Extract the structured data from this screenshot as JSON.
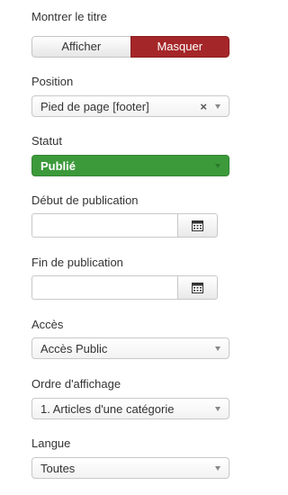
{
  "show_title": {
    "label": "Montrer le titre",
    "options": [
      "Afficher",
      "Masquer"
    ],
    "selected": "Masquer"
  },
  "position": {
    "label": "Position",
    "value": "Pied de page [footer]",
    "clear_glyph": "×"
  },
  "status": {
    "label": "Statut",
    "value": "Publié",
    "color": "#3c9a3b"
  },
  "publish_up": {
    "label": "Début de publication",
    "value": ""
  },
  "publish_down": {
    "label": "Fin de publication",
    "value": ""
  },
  "access": {
    "label": "Accès",
    "value": "Accès Public"
  },
  "ordering": {
    "label": "Ordre d'affichage",
    "value": "1. Articles d'une catégorie"
  },
  "language": {
    "label": "Langue",
    "value": "Toutes"
  },
  "colors": {
    "active_toggle": "#a52628",
    "published": "#3c9a3b"
  },
  "icons": {
    "calendar": "calendar-icon",
    "dropdown": "chevron-down-icon",
    "clear": "close-icon"
  }
}
